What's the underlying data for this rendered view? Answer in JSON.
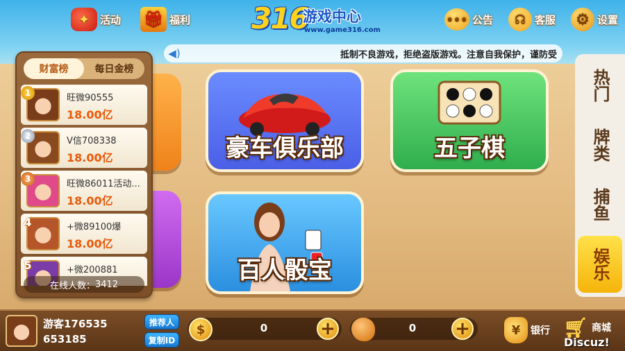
{
  "topbar": {
    "activity_label": "活动",
    "welfare_label": "福利",
    "notice_label": "公告",
    "service_label": "客服",
    "settings_label": "设置"
  },
  "logo": {
    "number": "316",
    "title": "游戏中心",
    "url": "www.game316.com"
  },
  "marquee": {
    "text": "抵制不良游戏，拒绝盗版游戏。注意自我保护，谨防受"
  },
  "leaderboard": {
    "tabs": [
      {
        "label": "财富榜",
        "active": true
      },
      {
        "label": "每日金榜",
        "active": false
      }
    ],
    "rows": [
      {
        "rank": "1",
        "name": "旺微90555",
        "money": "18.00亿"
      },
      {
        "rank": "2",
        "name": "V信708338",
        "money": "18.00亿"
      },
      {
        "rank": "3",
        "name": "旺微86011活动...",
        "money": "18.00亿"
      },
      {
        "rank": "4",
        "name": "+微89100爆",
        "money": "18.00亿"
      },
      {
        "rank": "5",
        "name": "+微200881",
        "money": ""
      }
    ],
    "online_label": "在线人数：",
    "online_count": "3412"
  },
  "games": {
    "car_club": "豪车俱乐部",
    "gomoku": "五子棋",
    "sicbo": "百人骰宝"
  },
  "categories": [
    {
      "label": "热门",
      "active": false
    },
    {
      "label": "牌类",
      "active": false
    },
    {
      "label": "捕鱼",
      "active": false
    },
    {
      "label": "娱乐",
      "active": true
    }
  ],
  "bottombar": {
    "username": "游客176535",
    "user_id": "653185",
    "referrer_label": "推荐人",
    "copy_id_label": "复制ID",
    "gold_value": "0",
    "bean_value": "0",
    "bank_label": "银行",
    "shop_label": "商城"
  },
  "watermark": "Discuz!",
  "colors": {
    "accent_orange": "#e85a0a",
    "active_tab_yellow": "#f5b40a",
    "wood_brown": "#7a4d26"
  }
}
